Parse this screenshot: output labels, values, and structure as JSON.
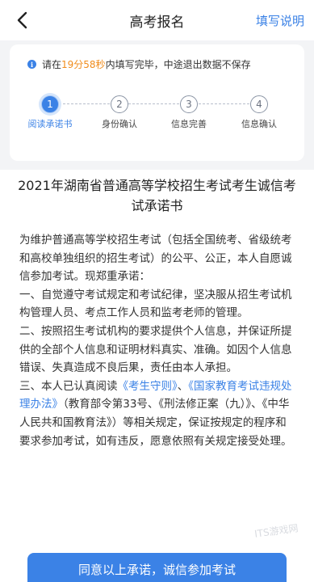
{
  "header": {
    "title": "高考报名",
    "help_link": "填写说明",
    "back_icon": "chevron-left-icon"
  },
  "notice": {
    "prefix": "请在",
    "timer": "19分58秒",
    "suffix": "内填写完毕，中途退出数据不保存",
    "icon": "info-icon"
  },
  "steps": [
    {
      "number": "1",
      "label": "阅读承诺书",
      "active": true
    },
    {
      "number": "2",
      "label": "身份确认",
      "active": false
    },
    {
      "number": "3",
      "label": "信息完善",
      "active": false
    },
    {
      "number": "4",
      "label": "信息确认",
      "active": false
    }
  ],
  "document": {
    "title": "2021年湖南省普通高等学校招生考试考生诚信考试承诺书",
    "intro": "为维护普通高等学校招生考试（包括全国统考、省级统考和高校单独组织的招生考试）的公平、公正，本人自愿诚信参加考试。现郑重承诺：",
    "item1": "一、自觉遵守考试规定和考试纪律，坚决服从招生考试机构管理人员、考点工作人员和监考老师的管理。",
    "item2": "二、按照招生考试机构的要求提供个人信息，并保证所提供的全部个人信息和证明材料真实、准确。如因个人信息错误、失真造成不良后果，责任由本人承担。",
    "item3_a": "三、本人已认真阅读",
    "link1": "《考生守则》",
    "item3_b": "、",
    "link2": "《国家教育考试违规处理办法》",
    "item3_c": "（教育部令第33号、《刑法修正案（九）》、《中华人民共和国教育法》）等相关规定，保证按规定的程序和要求参加考试，如有违反，愿意依照有关规定接受处理。"
  },
  "watermark": "ITS游戏网",
  "agree_button": "同意以上承诺，诚信参加考试",
  "colors": {
    "accent": "#3b82e6",
    "timer": "#f08c1c",
    "background_grey": "#f3f4f6"
  }
}
